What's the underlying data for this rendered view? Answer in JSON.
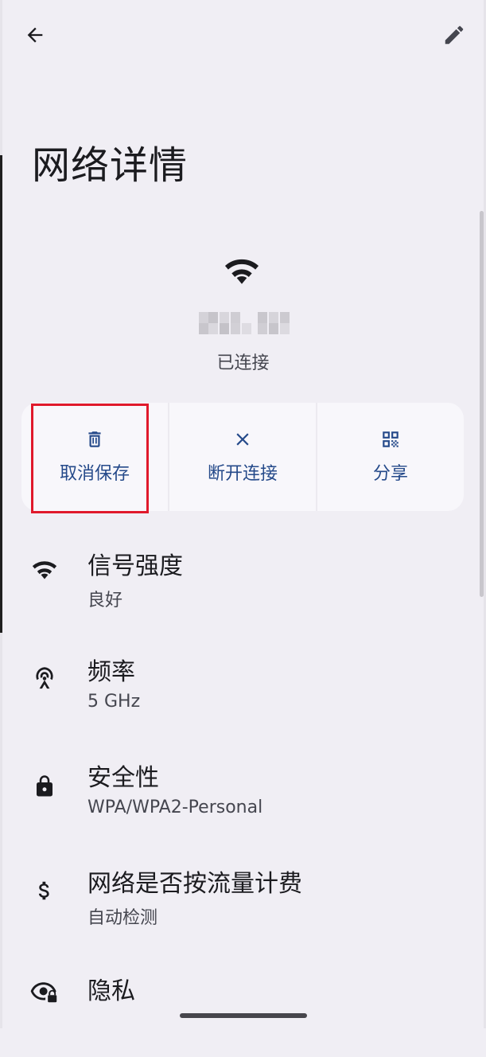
{
  "header": {
    "back_icon": "arrow-back-icon",
    "edit_icon": "edit-pencil-icon"
  },
  "page_title": "网络详情",
  "network": {
    "icon": "wifi-icon",
    "status": "已连接"
  },
  "actions": [
    {
      "label": "取消保存",
      "icon": "trash-icon"
    },
    {
      "label": "断开连接",
      "icon": "close-icon"
    },
    {
      "label": "分享",
      "icon": "qr-code-icon"
    }
  ],
  "details": [
    {
      "title": "信号强度",
      "value": "良好",
      "icon": "wifi-signal-icon"
    },
    {
      "title": "频率",
      "value": "5 GHz",
      "icon": "antenna-icon"
    },
    {
      "title": "安全性",
      "value": "WPA/WPA2-Personal",
      "icon": "lock-icon"
    },
    {
      "title": "网络是否按流量计费",
      "value": "自动检测",
      "icon": "dollar-icon"
    },
    {
      "title": "隐私",
      "value": "",
      "icon": "privacy-eye-icon"
    }
  ],
  "colors": {
    "background": "#f0eef4",
    "accent": "#254a8a",
    "highlight": "#e0192b"
  }
}
